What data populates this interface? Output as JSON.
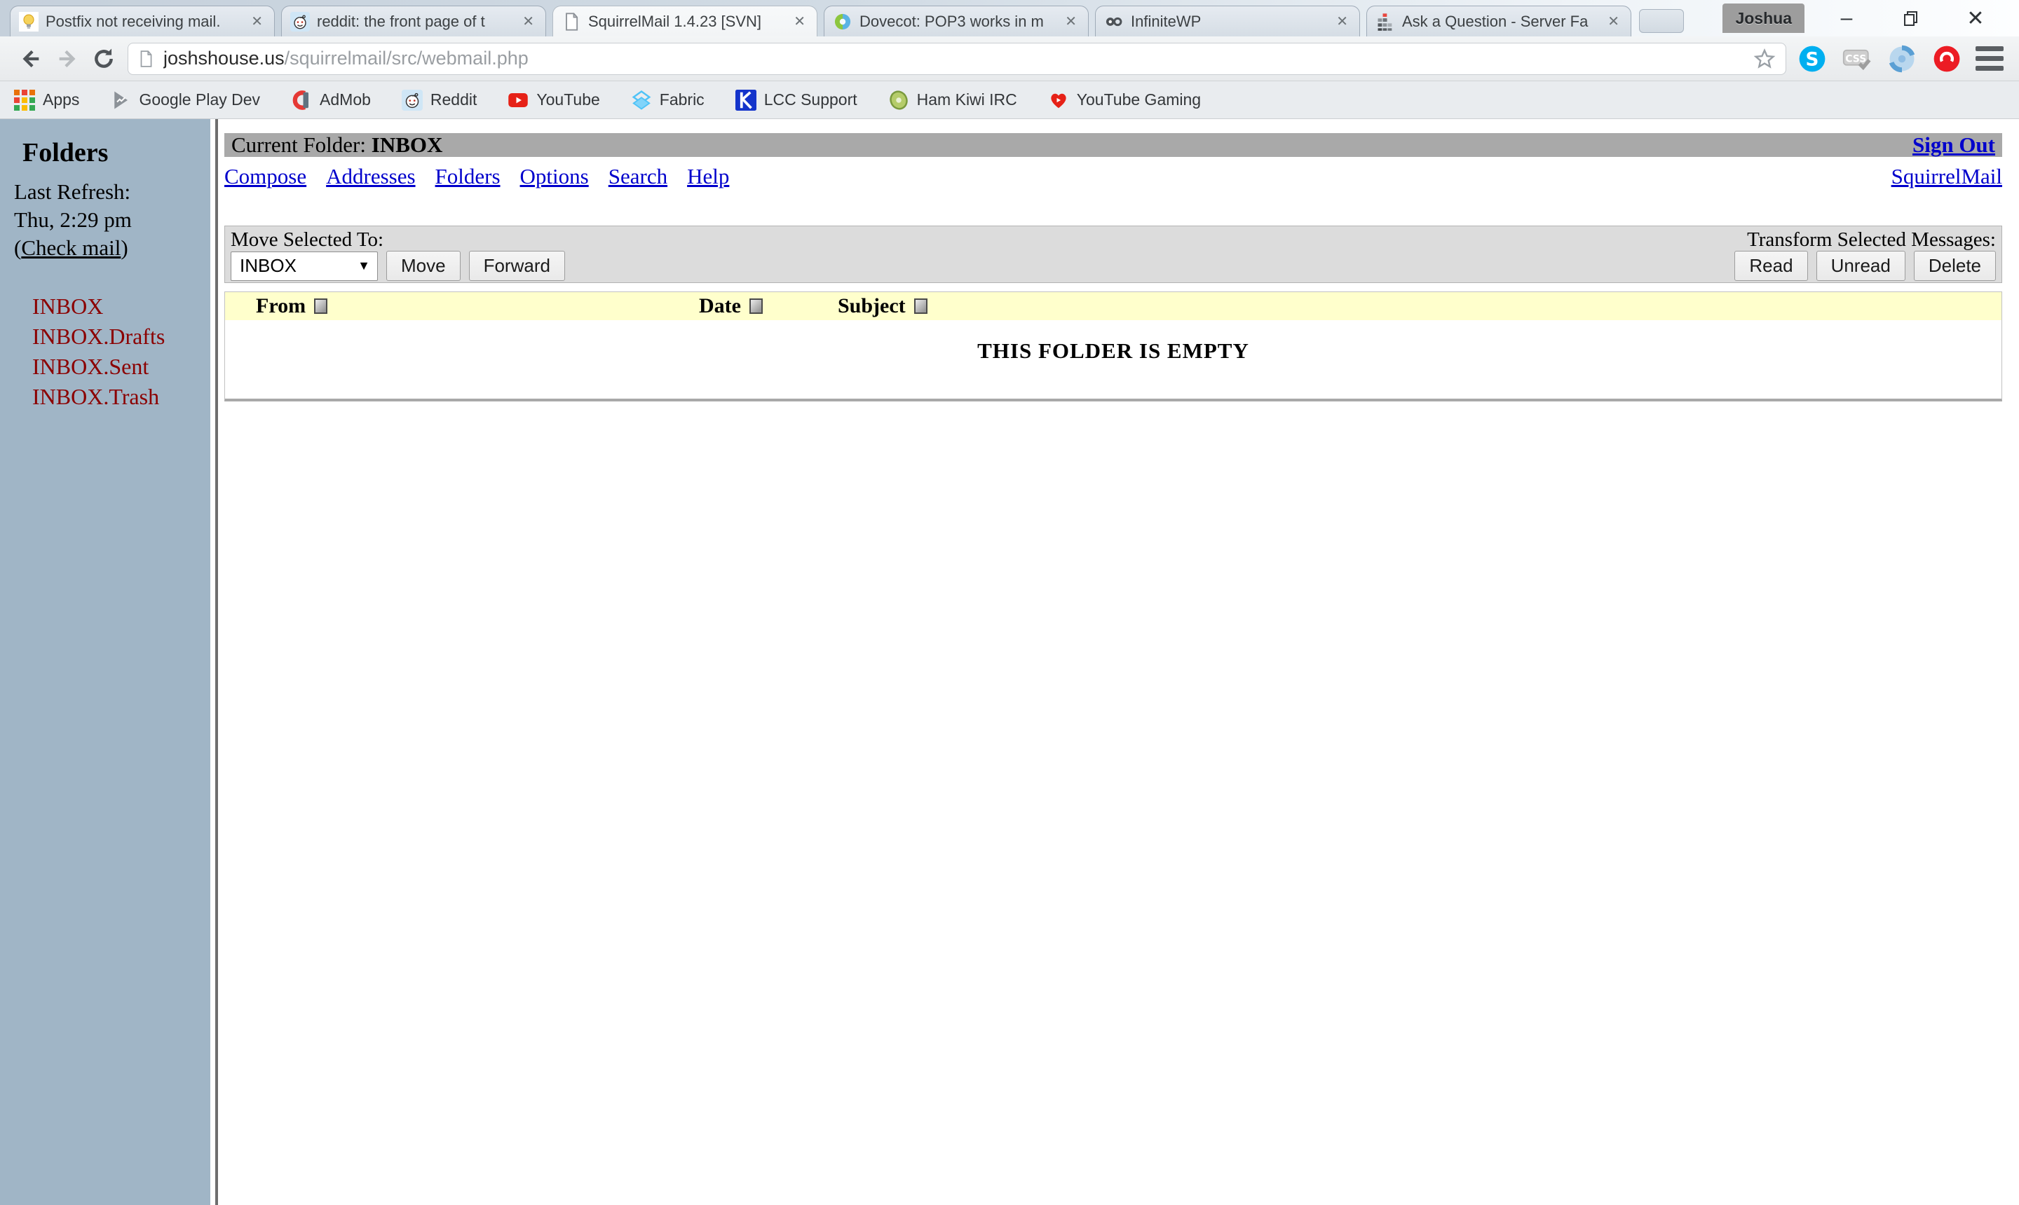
{
  "browser": {
    "tabs": [
      {
        "title": "Postfix not receiving mail.",
        "icon": "lightbulb-icon"
      },
      {
        "title": "reddit: the front page of t",
        "icon": "reddit-icon"
      },
      {
        "title": "SquirrelMail 1.4.23 [SVN]",
        "icon": "page-icon",
        "active": true
      },
      {
        "title": "Dovecot: POP3 works in m",
        "icon": "dovecot-icon"
      },
      {
        "title": "InfiniteWP",
        "icon": "infinitewp-icon"
      },
      {
        "title": "Ask a Question - Server Fa",
        "icon": "serverfault-icon"
      }
    ],
    "profile_name": "Joshua",
    "url": {
      "host": "joshshouse.us",
      "path": "/squirrelmail/src/webmail.php"
    },
    "bookmarks": [
      {
        "label": "Apps",
        "icon": "apps-grid-icon"
      },
      {
        "label": "Google Play Dev",
        "icon": "play-dev-icon"
      },
      {
        "label": "AdMob",
        "icon": "admob-icon"
      },
      {
        "label": "Reddit",
        "icon": "reddit-icon"
      },
      {
        "label": "YouTube",
        "icon": "youtube-icon"
      },
      {
        "label": "Fabric",
        "icon": "fabric-icon"
      },
      {
        "label": "LCC Support",
        "icon": "lcc-icon"
      },
      {
        "label": "Ham Kiwi IRC",
        "icon": "kiwi-icon"
      },
      {
        "label": "YouTube Gaming",
        "icon": "youtube-gaming-icon"
      }
    ],
    "glyphs": {
      "close": "✕",
      "minimize": "–",
      "select_arrow": "▼",
      "infinity": "∞"
    }
  },
  "sidebar": {
    "title": "Folders",
    "last_refresh_label": "Last Refresh:",
    "last_refresh_time": "Thu, 2:29 pm",
    "paren_open": "(",
    "check_mail_link": "Check mail",
    "paren_close": ")",
    "folders": [
      "INBOX",
      "INBOX.Drafts",
      "INBOX.Sent",
      "INBOX.Trash"
    ]
  },
  "main": {
    "current_folder_label": "Current Folder: ",
    "current_folder": "INBOX",
    "sign_out": "Sign Out",
    "menu": [
      "Compose",
      "Addresses",
      "Folders",
      "Options",
      "Search",
      "Help"
    ],
    "brand_link": "SquirrelMail",
    "move_label": "Move Selected To:",
    "move_select_value": "INBOX",
    "move_button": "Move",
    "forward_button": "Forward",
    "transform_label": "Transform Selected Messages:",
    "read_button": "Read",
    "unread_button": "Unread",
    "delete_button": "Delete",
    "columns": [
      "From",
      "Date",
      "Subject"
    ],
    "empty_message": "THIS FOLDER IS EMPTY"
  },
  "colors": {
    "link_blue": "#0000cc",
    "folder_red": "#8b0000",
    "sidebar_bg": "#a0b5c6",
    "bar_gray": "#a9a9a9",
    "band_gray": "#dcdcdc",
    "header_yellow": "#ffffcc"
  }
}
